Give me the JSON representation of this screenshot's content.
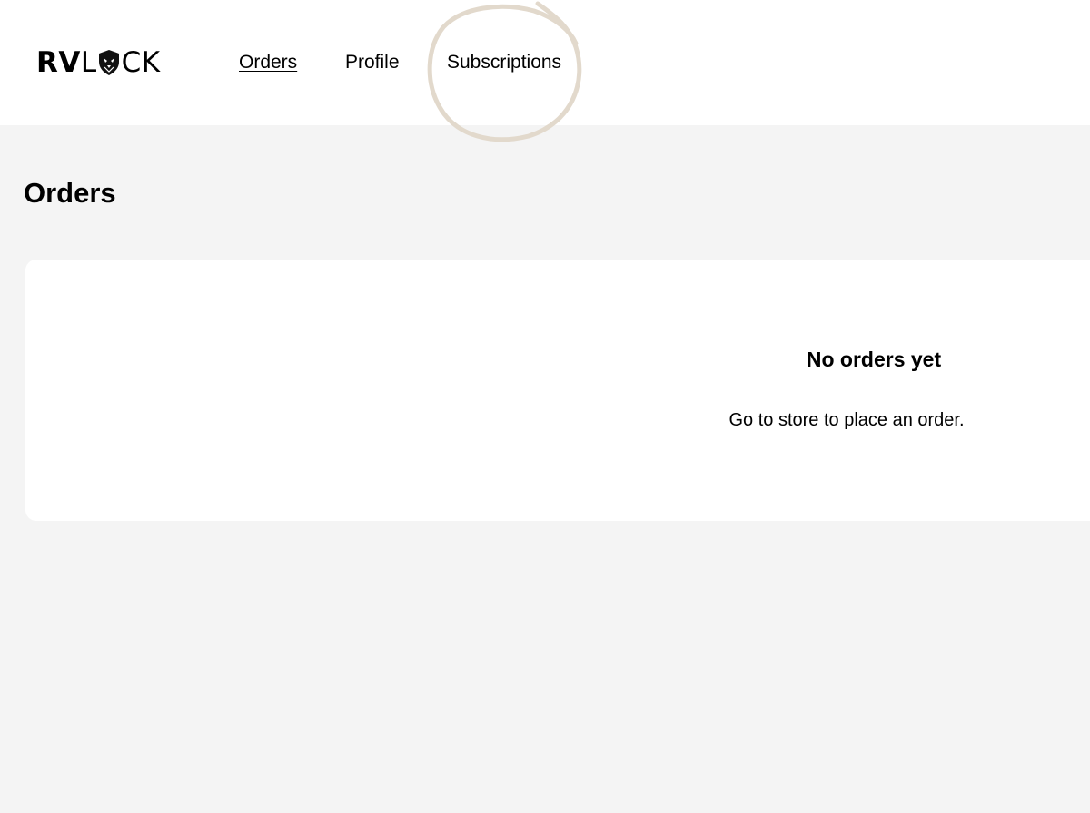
{
  "brand": {
    "logo_part1": "RV",
    "logo_part2": "CK"
  },
  "nav": {
    "items": [
      {
        "label": "Orders",
        "active": true
      },
      {
        "label": "Profile",
        "active": false
      },
      {
        "label": "Subscriptions",
        "active": false,
        "highlighted": true
      }
    ]
  },
  "main": {
    "title": "Orders",
    "empty_state": {
      "title": "No orders yet",
      "message": "Go to store to place an order."
    }
  },
  "colors": {
    "header_bg": "#ffffff",
    "page_bg": "#f4f4f4",
    "card_bg": "#ffffff",
    "highlight_ring": "#e2d9cc"
  }
}
